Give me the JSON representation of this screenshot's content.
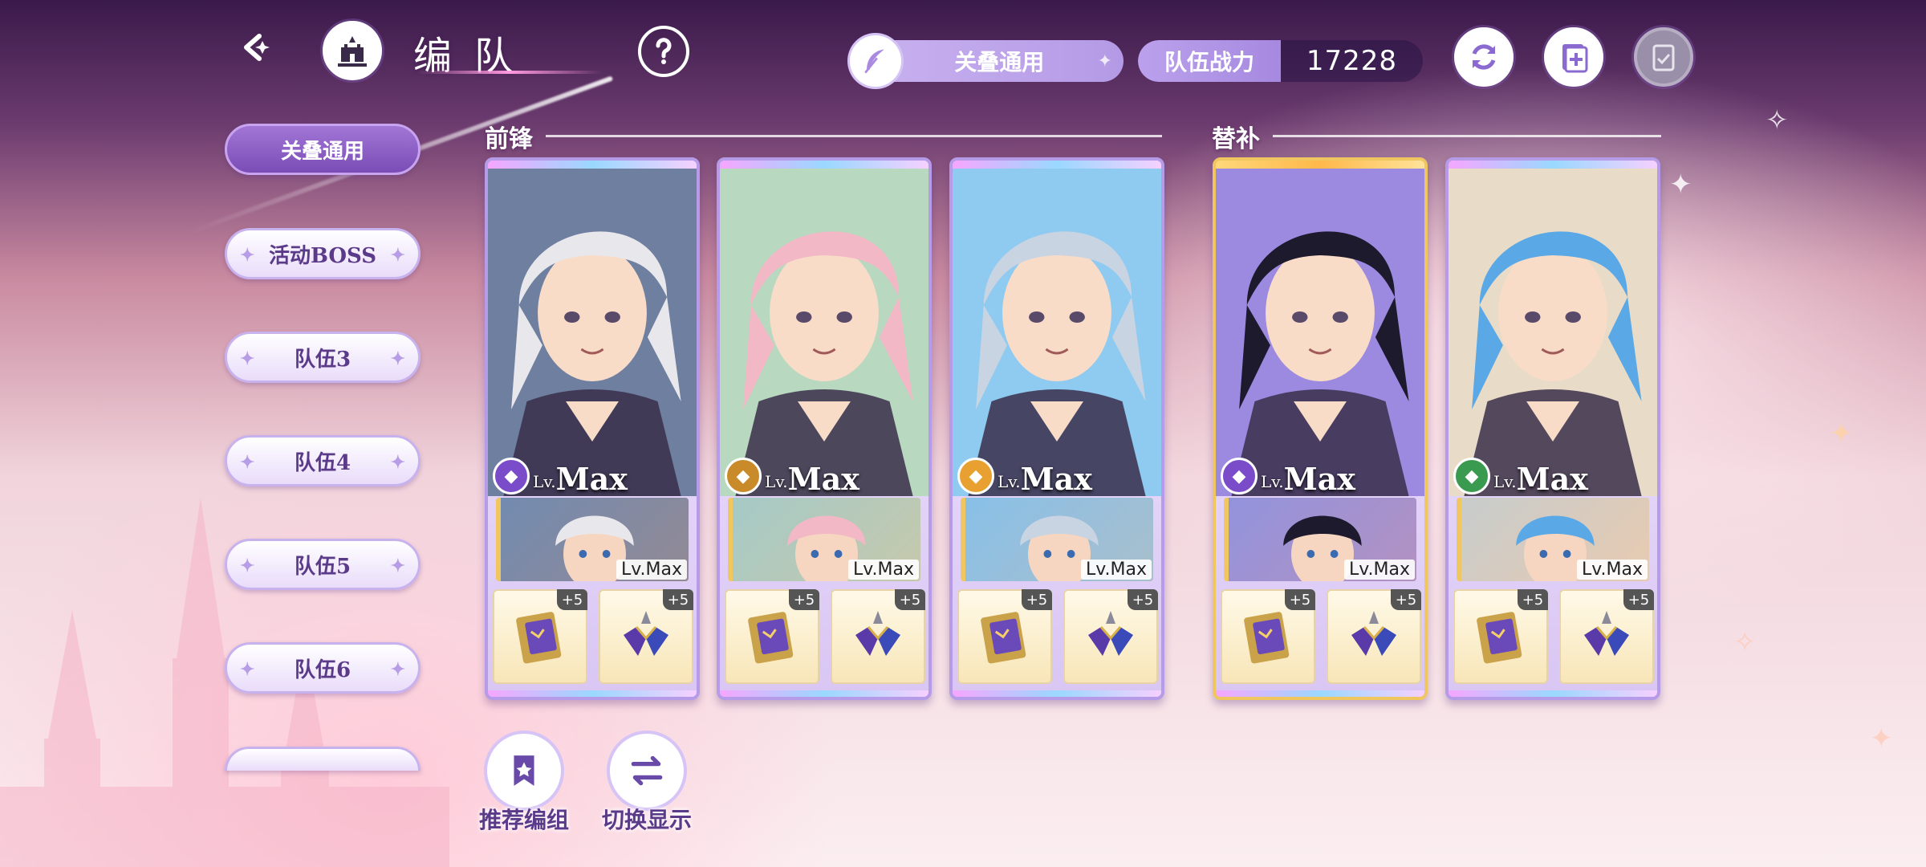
{
  "header": {
    "title": "编队",
    "filter_label": "关叠通用",
    "power_label": "队伍战力",
    "power_value": "17228"
  },
  "teams": [
    {
      "label": "关叠通用",
      "active": true
    },
    {
      "label": "活动BOSS",
      "active": false
    },
    {
      "label": "队伍3",
      "active": false
    },
    {
      "label": "队伍4",
      "active": false
    },
    {
      "label": "队伍5",
      "active": false
    },
    {
      "label": "队伍6",
      "active": false
    }
  ],
  "sections": {
    "front": "前锋",
    "sub": "替补"
  },
  "cards": [
    {
      "lv_prefix": "Lv.",
      "lv": "Max",
      "element_color": "#7b4cc9",
      "support_lv": "Lv.Max",
      "item1_plus": "+5",
      "item2_plus": "+5",
      "hair": "#e8e8ec",
      "bg": "#6f7fa0"
    },
    {
      "lv_prefix": "Lv.",
      "lv": "Max",
      "element_color": "#c98a2a",
      "support_lv": "Lv.Max",
      "item1_plus": "+5",
      "item2_plus": "+5",
      "hair": "#f3b8c6",
      "bg": "#b8d8c0"
    },
    {
      "lv_prefix": "Lv.",
      "lv": "Max",
      "element_color": "#e8a030",
      "support_lv": "Lv.Max",
      "item1_plus": "+5",
      "item2_plus": "+5",
      "hair": "#c8d4e2",
      "bg": "#8fcaf0"
    },
    {
      "lv_prefix": "Lv.",
      "lv": "Max",
      "element_color": "#7b4cc9",
      "support_lv": "Lv.Max",
      "item1_plus": "+5",
      "item2_plus": "+5",
      "hair": "#1e1a2e",
      "bg": "#9c8ae0"
    },
    {
      "lv_prefix": "Lv.",
      "lv": "Max",
      "element_color": "#3a9a50",
      "support_lv": "Lv.Max",
      "item1_plus": "+5",
      "item2_plus": "+5",
      "hair": "#5aa8e6",
      "bg": "#e8dcc8"
    }
  ],
  "actions": {
    "recommend": "推荐编组",
    "toggle": "切换显示"
  },
  "icons": {
    "back": "back-arrow-icon",
    "home": "castle-icon",
    "help": "question-icon",
    "feather": "feather-icon",
    "refresh": "refresh-icon",
    "add": "add-page-icon",
    "copy": "clipboard-icon"
  }
}
